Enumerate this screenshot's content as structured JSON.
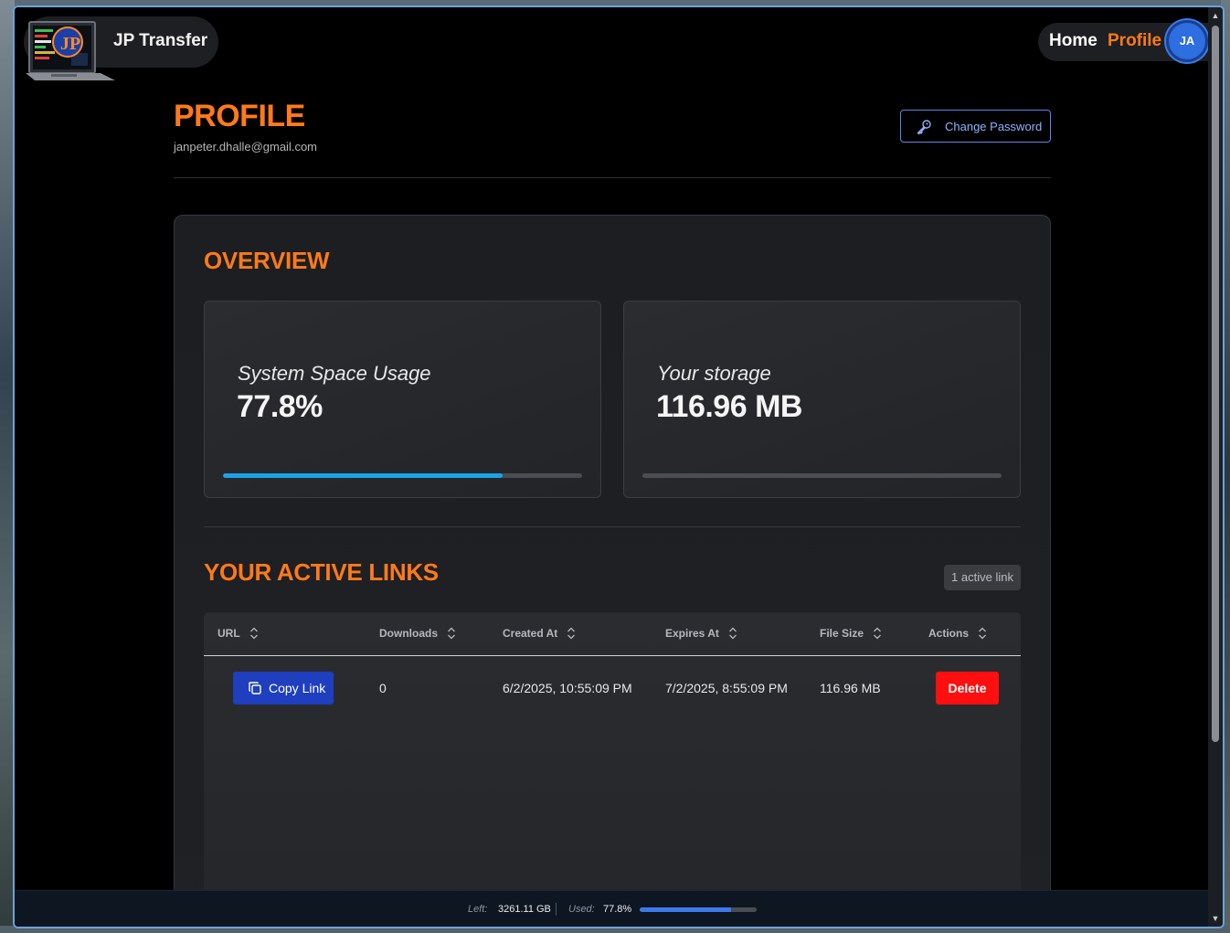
{
  "brand": {
    "title": "JP Transfer"
  },
  "nav": {
    "home": "Home",
    "profile": "Profile",
    "avatar_initials": "JA"
  },
  "profile": {
    "title": "PROFILE",
    "email": "janpeter.dhalle@gmail.com",
    "change_password": "Change Password"
  },
  "overview": {
    "title": "OVERVIEW",
    "system": {
      "label": "System Space Usage",
      "value": "77.8%",
      "progress": 0.778
    },
    "storage": {
      "label": "Your storage",
      "value": "116.96 MB",
      "progress": 0.0
    }
  },
  "links": {
    "title": "YOUR ACTIVE LINKS",
    "badge": "1 active link",
    "columns": [
      "URL",
      "Downloads",
      "Created At",
      "Expires At",
      "File Size",
      "Actions"
    ],
    "rows": [
      {
        "copy_label": "Copy Link",
        "downloads": "0",
        "created_at": "6/2/2025, 10:55:09 PM",
        "expires_at": "7/2/2025, 8:55:09 PM",
        "file_size": "116.96 MB",
        "delete_label": "Delete"
      }
    ]
  },
  "statusbar": {
    "left_label": "Left:",
    "left_value": "3261.11 GB",
    "used_label": "Used:",
    "used_value": "77.8%",
    "used_progress": 0.778
  },
  "colors": {
    "accent_orange": "#ff7a1a",
    "progress_blue": "#1aa3e8",
    "delete_red": "#ff0f0f",
    "copy_blue": "#1f3fbf"
  }
}
